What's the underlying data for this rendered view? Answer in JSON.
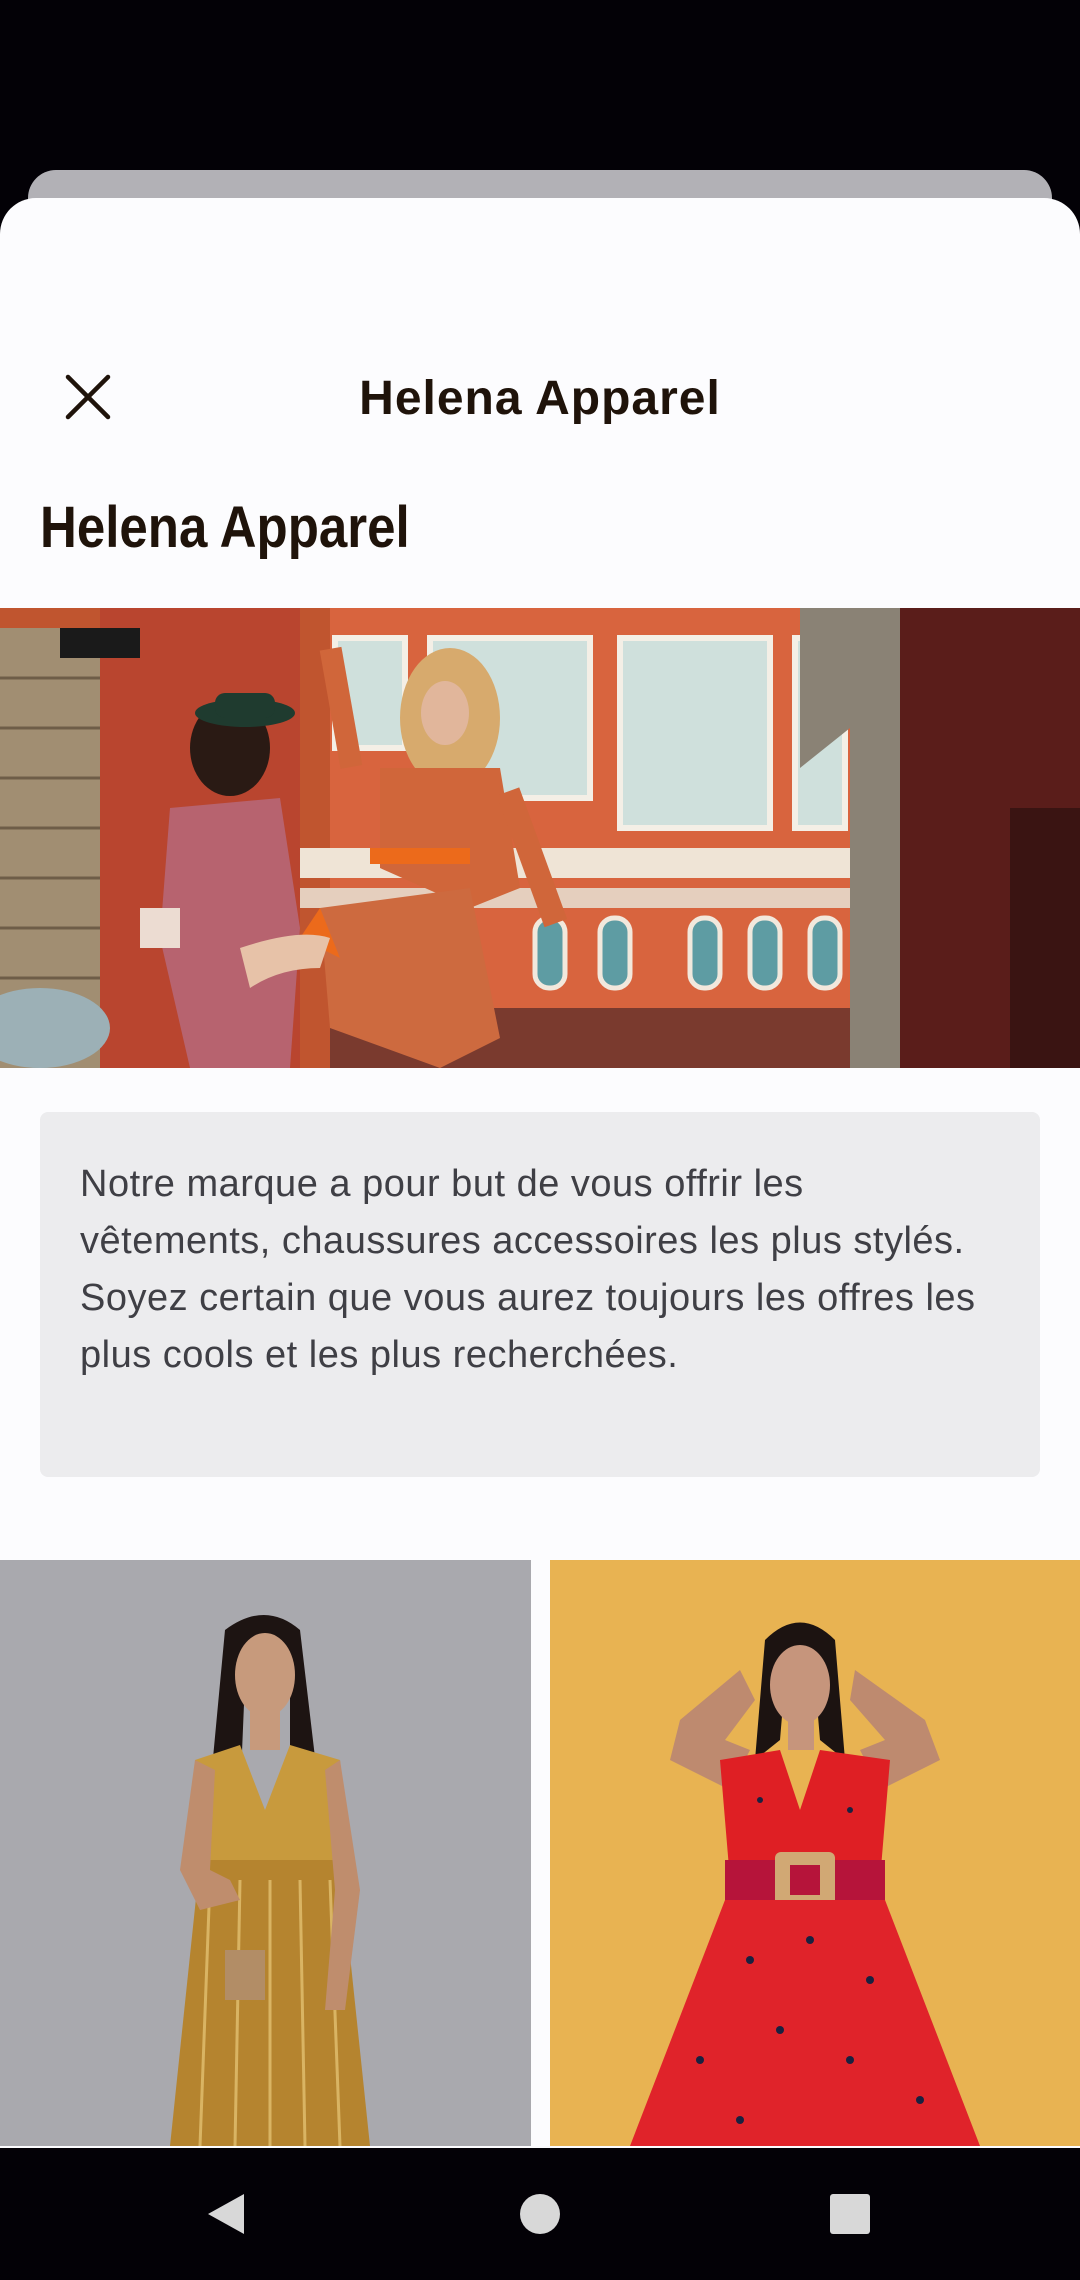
{
  "header": {
    "title": "Helena Apparel",
    "close_icon": "close-icon"
  },
  "brand": {
    "name": "Helena Apparel"
  },
  "hero_image": {
    "icon": "brand-hero-photo"
  },
  "description": "Notre marque a pour but de vous offrir les vêtements, chaussures accessoires les plus stylés. Soyez certain que vous aurez toujours les offres les plus cools et les plus recherchées.",
  "products": [
    {
      "icon": "gold-sequin-dress-photo",
      "bg": "#a9a9ae"
    },
    {
      "icon": "red-floral-dress-photo",
      "bg": "#e8b352"
    }
  ],
  "navigation": {
    "back_icon": "back-triangle-icon",
    "home_icon": "home-circle-icon",
    "recents_icon": "recents-square-icon"
  },
  "colors": {
    "text_dark": "#1f130a",
    "sheet_bg": "#fcfcfe",
    "desc_bg": "#ececee",
    "system_bar": "#030106"
  }
}
